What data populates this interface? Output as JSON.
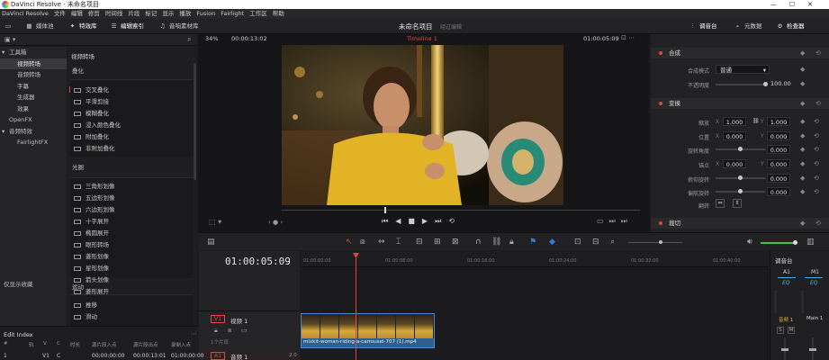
{
  "app": {
    "title": "DaVinci Resolve - 未命名项目",
    "window_controls": [
      "—",
      "☐",
      "✕"
    ]
  },
  "menu": [
    "DaVinci Resolve",
    "文件",
    "编辑",
    "修剪",
    "时间线",
    "片段",
    "标记",
    "显示",
    "播放",
    "Fusion",
    "Fairlight",
    "工作区",
    "帮助"
  ],
  "toolbar": {
    "media_pool": "媒体池",
    "effects": "特效库",
    "edit_index": "编辑索引",
    "sound_library": "音响素材库",
    "project": "未命名项目",
    "project_status": "经过编辑",
    "mixer": "调音台",
    "metadata": "元数据",
    "inspector": "检查器"
  },
  "viewer": {
    "zoom": "34%",
    "timecode_left": "00:00:13:02",
    "timeline_name": "Timeline 1",
    "timecode_right": "01:00:05:09"
  },
  "sidebar": {
    "items": [
      {
        "label": "工具箱",
        "sub": false,
        "selected": false,
        "arrow": "▾"
      },
      {
        "label": "视频转场",
        "sub": true,
        "selected": true
      },
      {
        "label": "音频转场",
        "sub": true,
        "selected": false
      },
      {
        "label": "字幕",
        "sub": true,
        "selected": false
      },
      {
        "label": "生成器",
        "sub": true,
        "selected": false
      },
      {
        "label": "效果",
        "sub": true,
        "selected": false
      },
      {
        "label": "OpenFX",
        "sub": false,
        "selected": false,
        "arrow": ""
      },
      {
        "label": "音频特效",
        "sub": false,
        "selected": false,
        "arrow": "▾"
      },
      {
        "label": "FairlightFX",
        "sub": true,
        "selected": false
      }
    ],
    "favorites": "仅显示收藏"
  },
  "library": {
    "title": "视频转场",
    "groups": [
      {
        "label": "叠化",
        "items": [
          "交叉叠化",
          "平滑剪接",
          "模糊叠化",
          "浸入颜色叠化",
          "附加叠化",
          "非附加叠化"
        ]
      },
      {
        "label": "光圈",
        "items": [
          "三角形划像",
          "五边形划像",
          "六边形划像",
          "十字展开",
          "椭圆展开",
          "眼形转场",
          "菱形划像",
          "星形划像",
          "箭头划像",
          "菱形展开"
        ]
      },
      {
        "label": "运动",
        "items": [
          "推移",
          "滑动"
        ]
      }
    ]
  },
  "inspector": {
    "composite": {
      "header": "合成",
      "mode_label": "合成模式",
      "mode_value": "普通",
      "opacity_label": "不透明度",
      "opacity_value": "100.00"
    },
    "transform": {
      "header": "变换",
      "zoom_label": "缩放",
      "zoom_x": "1.000",
      "zoom_y": "1.000",
      "position_label": "位置",
      "position_x": "0.000",
      "position_y": "0.000",
      "rotation_label": "旋转角度",
      "rotation_value": "0.000",
      "anchor_label": "锚点",
      "anchor_x": "0.000",
      "anchor_y": "0.000",
      "pitch_label": "俯仰旋转",
      "pitch_value": "0.000",
      "yaw_label": "偏航旋转",
      "yaw_value": "0.000",
      "flip_label": "翻转"
    },
    "crop": {
      "header": "裁切"
    }
  },
  "timeline": {
    "timecode": "01:00:05:09",
    "ruler": [
      "01:00:00:00",
      "01:00:08:00",
      "01:00:16:00",
      "01:00:24:00",
      "01:00:32:00",
      "01:00:40:00"
    ],
    "video_track": {
      "id": "V1",
      "name": "视频 1",
      "clip_count": "1个片段"
    },
    "audio_track": {
      "id": "A1",
      "name": "音频 1",
      "level": "2.0"
    },
    "clip_name": "mixkit-woman-riding-a-carrousel-707 (1).mp4"
  },
  "mixer": {
    "title": "调音台",
    "channels": [
      "A1",
      "M1"
    ],
    "eq": "EQ",
    "bus_a1": "音频 1",
    "bus_main": "Main 1",
    "s_label": "S",
    "m_label": "M"
  },
  "edit_index": {
    "title": "Edit Index",
    "columns": [
      "#",
      "轨",
      "V",
      "C",
      "时长",
      "源片段入点",
      "源片段出点",
      "录制入点"
    ],
    "row": {
      "num": "1",
      "track": "V1",
      "v": "C",
      "c": "",
      "duration": "00:00:00:00",
      "src_in": "00:00:13:01",
      "src_out": "01:00:00:00",
      "rec_in": ""
    }
  },
  "colors": {
    "accent_red": "#e2443c",
    "clip_blue": "#2e5f8e",
    "eq_blue": "#4aa3e0",
    "level_green": "#3ac24a"
  }
}
